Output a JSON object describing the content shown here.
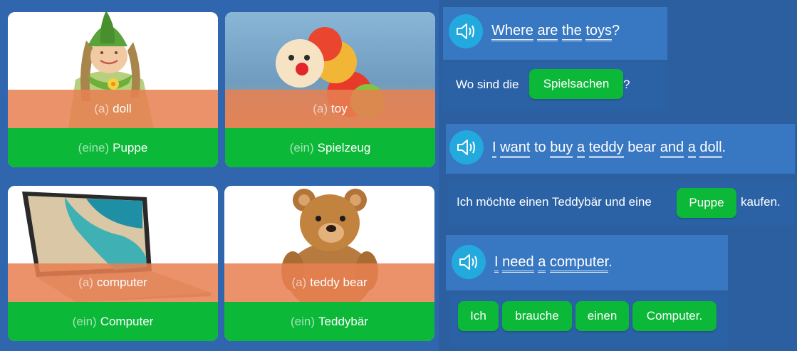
{
  "cards": [
    {
      "english_article": "(a)",
      "english_word": "doll",
      "german_article": "(eine)",
      "german_word": "Puppe"
    },
    {
      "english_article": "(a)",
      "english_word": "toy",
      "german_article": "(ein)",
      "german_word": "Spielzeug"
    },
    {
      "english_article": "(a)",
      "english_word": "computer",
      "german_article": "(ein)",
      "german_word": "Computer"
    },
    {
      "english_article": "(a)",
      "english_word": "teddy bear",
      "german_article": "(ein)",
      "german_word": "Teddybär"
    }
  ],
  "sentences": [
    {
      "english": [
        "Where",
        "are",
        "the",
        "toys"
      ],
      "english_end": "?",
      "german_before": "Wo sind die",
      "german_chip": "Spielsachen",
      "german_after": "?"
    },
    {
      "english": [
        "I",
        "want",
        "to",
        "buy",
        "a",
        "teddy",
        "bear",
        "and",
        "a",
        "doll"
      ],
      "english_end": ".",
      "german_before": "Ich möchte einen Teddybär und eine",
      "german_chip": "Puppe",
      "german_after": "kaufen."
    },
    {
      "english": [
        "I",
        "need",
        "a",
        "computer"
      ],
      "english_end": ".",
      "german_chips": [
        "Ich",
        "brauche",
        "einen",
        "Computer."
      ]
    }
  ],
  "colors": {
    "page_blue": "#2f66ae",
    "accent_green": "#0cb838",
    "translation_band": "#e88052",
    "speaker_button": "#22a9dd"
  },
  "icons": {
    "audio": "speaker-icon"
  }
}
